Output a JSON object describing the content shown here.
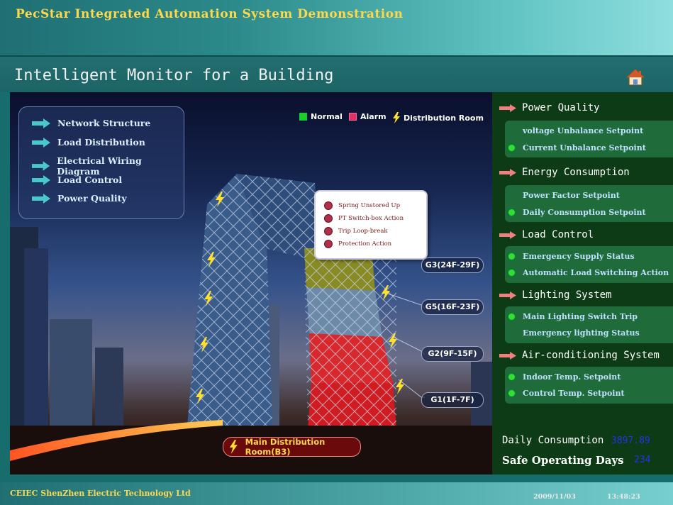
{
  "header": {
    "app_title": "PecStar Integrated Automation System Demonstration",
    "page_title": "Intelligent Monitor for a Building",
    "home_icon": "home-icon"
  },
  "nav_menu": [
    {
      "label": "Network Structure"
    },
    {
      "label": "Load Distribution"
    },
    {
      "label": "Electrical Wiring Diagram"
    },
    {
      "label": "Load Control"
    },
    {
      "label": "Power Quality"
    }
  ],
  "legend": {
    "normal": "Normal",
    "alarm": "Alarm",
    "distribution_room": "Distribution Room"
  },
  "status_popup": [
    "Spring Unstored Up",
    "PT Switch-box Action",
    "Trip Loop-break",
    "Protection Action"
  ],
  "floors": [
    {
      "label": "G3(24F-29F)"
    },
    {
      "label": "G5(16F-23F)"
    },
    {
      "label": "G2(9F-15F)"
    },
    {
      "label": "G1(1F-7F)"
    }
  ],
  "main_room": "Main Distribution Room(B3)",
  "categories": [
    {
      "label": "Power Quality",
      "items": [
        {
          "label": "voltage Unbalance Setpoint",
          "status": "none"
        },
        {
          "label": "Current Unbalance Setpoint",
          "status": "normal"
        }
      ]
    },
    {
      "label": "Energy Consumption",
      "items": [
        {
          "label": "Power Factor Setpoint",
          "status": "none"
        },
        {
          "label": "Daily Consumption Setpoint",
          "status": "normal"
        }
      ]
    },
    {
      "label": "Load Control",
      "items": [
        {
          "label": "Emergency Supply Status",
          "status": "normal"
        },
        {
          "label": "Automatic Load Switching Action",
          "status": "normal"
        }
      ]
    },
    {
      "label": "Lighting System",
      "items": [
        {
          "label": "Main Lighting Switch Trip",
          "status": "normal"
        },
        {
          "label": "Emergency lighting Status",
          "status": "none"
        }
      ]
    },
    {
      "label": "Air-conditioning System",
      "items": [
        {
          "label": "Indoor Temp. Setpoint",
          "status": "normal"
        },
        {
          "label": "Control Temp. Setpoint",
          "status": "normal"
        }
      ]
    }
  ],
  "stats": {
    "daily_consumption_label": "Daily Consumption",
    "daily_consumption_value": "3897.89",
    "safe_days_label": "Safe Operating Days",
    "safe_days_value": "234"
  },
  "footer": {
    "company": "CEIEC ShenZhen Electric Technology Ltd",
    "date": "2009/11/03",
    "time": "13:48:23"
  },
  "colors": {
    "accent_yellow": "#ffd84a",
    "normal_green": "#1fd01f",
    "alarm_red": "#e23060",
    "value_blue": "#2233ee"
  }
}
